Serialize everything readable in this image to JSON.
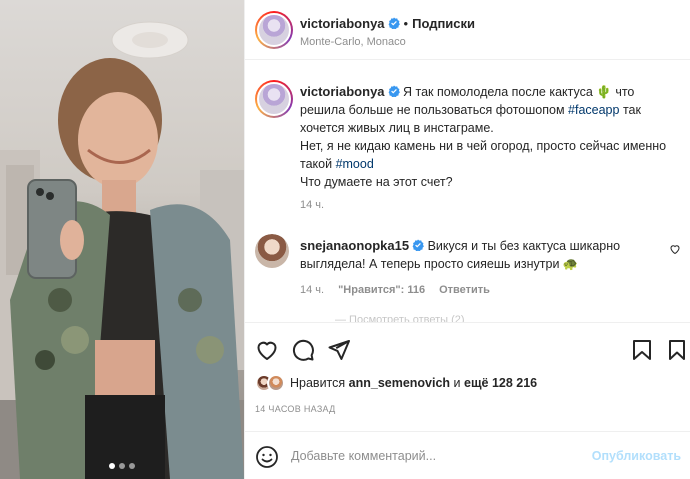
{
  "post": {
    "author": "victoriabonya",
    "follow_label": "Подписки",
    "separator": "•",
    "location": "Monte-Carlo, Monaco",
    "caption": {
      "username": "victoriabonya",
      "text_1": " Я так помолодела после кактуса ",
      "emoji_cactus": "🌵",
      "text_2": " что решила больше не пользоваться фотошопом ",
      "hashtag_1": "#faceapp",
      "text_3": " так хочется живых лиц в инстаграме.",
      "text_4": "Нет, я не кидаю камень ни в чей огород, просто сейчас именно такой ",
      "hashtag_2": "#mood",
      "text_5": "Что думаете на этот счет?",
      "time": "14 ч."
    },
    "comment": {
      "username": "snejanaonopka15",
      "text": " Викуся и ты без кактуса шикарно выглядела! А теперь просто сияешь изнутри ",
      "emoji": "🐢",
      "time": "14 ч.",
      "likes_label": "\"Нравится\": 116",
      "reply_label": "Ответить"
    },
    "more_replies": "— Посмотреть ответы (2)",
    "likes": {
      "prefix": "Нравится ",
      "user": "ann_semenovich",
      "middle": " и ",
      "rest": "ещё 128 216"
    },
    "timestamp": "14 ЧАСОВ НАЗАД",
    "comment_box": {
      "placeholder": "Добавьте комментарий...",
      "publish_label": "Опубликовать"
    }
  },
  "icons": [
    "verified-icon",
    "heart-icon",
    "comment-icon",
    "share-icon",
    "bookmark-icon",
    "tag-icon",
    "emoji-icon"
  ],
  "colors": {
    "verified": "#3897f0",
    "hashtag": "#00376b",
    "publish": "#b2dffc",
    "muted": "#8e8e8e"
  }
}
